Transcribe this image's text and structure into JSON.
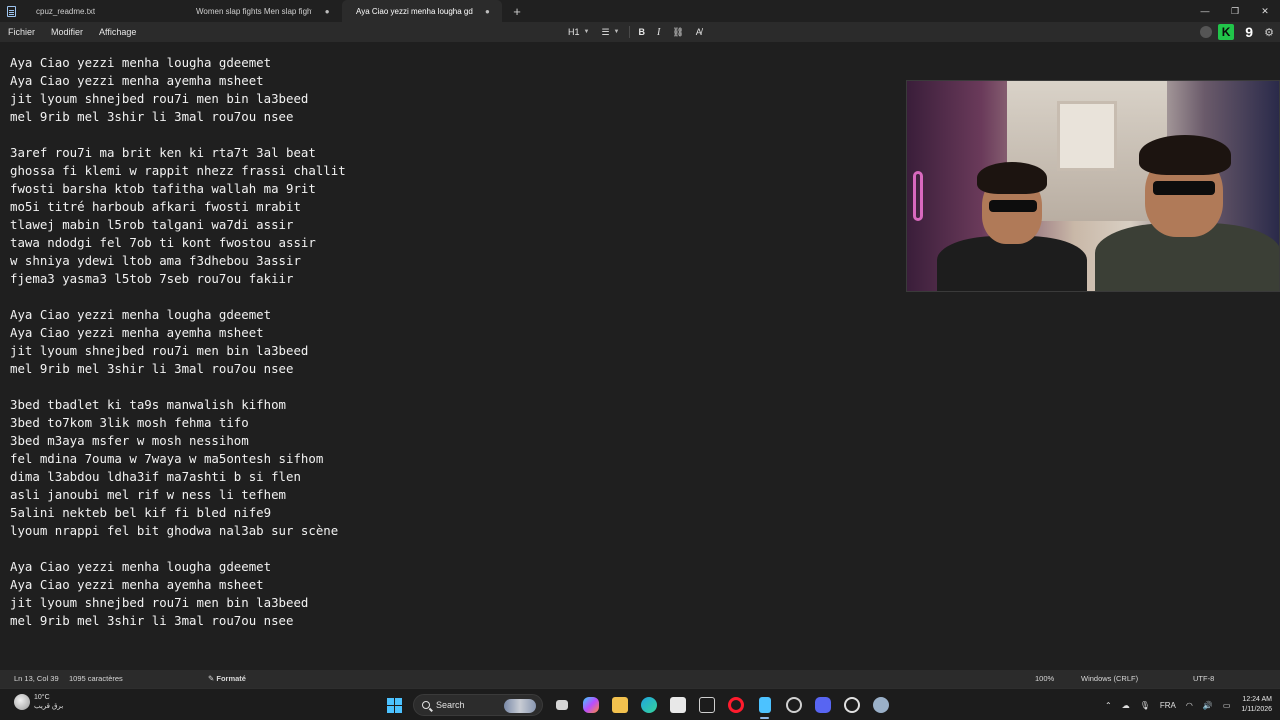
{
  "tabs": [
    {
      "label": "cpuz_readme.txt",
      "active": false
    },
    {
      "label": "Women slap fights  Men slap fights",
      "active": false
    },
    {
      "label": "Aya Ciao yezzi menha lougha gdee",
      "active": true
    }
  ],
  "window_controls": {
    "minimize": "—",
    "maximize": "❐",
    "close": "✕"
  },
  "menu": [
    "Fichier",
    "Modifier",
    "Affichage"
  ],
  "format_toolbar": {
    "heading": "H1",
    "list": "☰",
    "bold": "B",
    "italic": "I",
    "link": "⛓",
    "clear": "A̸"
  },
  "right_tools": {
    "k": "K",
    "nine": "9",
    "settings": "⚙"
  },
  "document_lines": [
    "Aya Ciao yezzi menha lougha gdeemet",
    "Aya Ciao yezzi menha ayemha msheet",
    "jit lyoum shnejbed rou7i men bin la3beed",
    "mel 9rib mel 3shir li 3mal rou7ou nsee",
    "",
    "3aref rou7i ma brit ken ki rta7t 3al beat",
    "ghossa fi klemi w rappit nhezz frassi challit",
    "fwosti barsha ktob tafitha wallah ma 9rit",
    "mo5i titré harboub afkari fwosti mrabit",
    "tlawej mabin l5rob talgani wa7di assir",
    "tawa ndodgi fel 7ob ti kont fwostou assir",
    "w shniya ydewi ltob ama f3dhebou 3assir",
    "fjema3 yasma3 l5tob 7seb rou7ou fakiir",
    "",
    "Aya Ciao yezzi menha lougha gdeemet",
    "Aya Ciao yezzi menha ayemha msheet",
    "jit lyoum shnejbed rou7i men bin la3beed",
    "mel 9rib mel 3shir li 3mal rou7ou nsee",
    "",
    "3bed tbadlet ki ta9s manwalish kifhom",
    "3bed to7kom 3lik mosh fehma tifo",
    "3bed m3aya msfer w mosh nessihom",
    "fel mdina 7ouma w 7waya w ma5ontesh sifhom",
    "dima l3abdou ldha3if ma7ashti b si flen",
    "asli janoubi mel rif w ness li tefhem",
    "5alini nekteb bel kif fi bled nife9",
    "lyoum nrappi fel bit ghodwa nal3ab sur scène",
    "",
    "Aya Ciao yezzi menha lougha gdeemet",
    "Aya Ciao yezzi menha ayemha msheet",
    "jit lyoum shnejbed rou7i men bin la3beed",
    "mel 9rib mel 3shir li 3mal rou7ou nsee"
  ],
  "status": {
    "position": "Ln 13, Col 39",
    "chars": "1095 caractères",
    "format": "Formaté",
    "zoom": "100%",
    "line_ending": "Windows (CRLF)",
    "encoding": "UTF-8"
  },
  "taskbar": {
    "weather_temp": "10°C",
    "weather_desc": "برق قريب",
    "search_label": "Search",
    "language": "FRA",
    "time": "12:24 AM",
    "date": "1/11/2026"
  },
  "colors": {
    "background": "#1f1f1f",
    "chrome": "#2b2b2b",
    "accent": "#4cc2ff"
  }
}
